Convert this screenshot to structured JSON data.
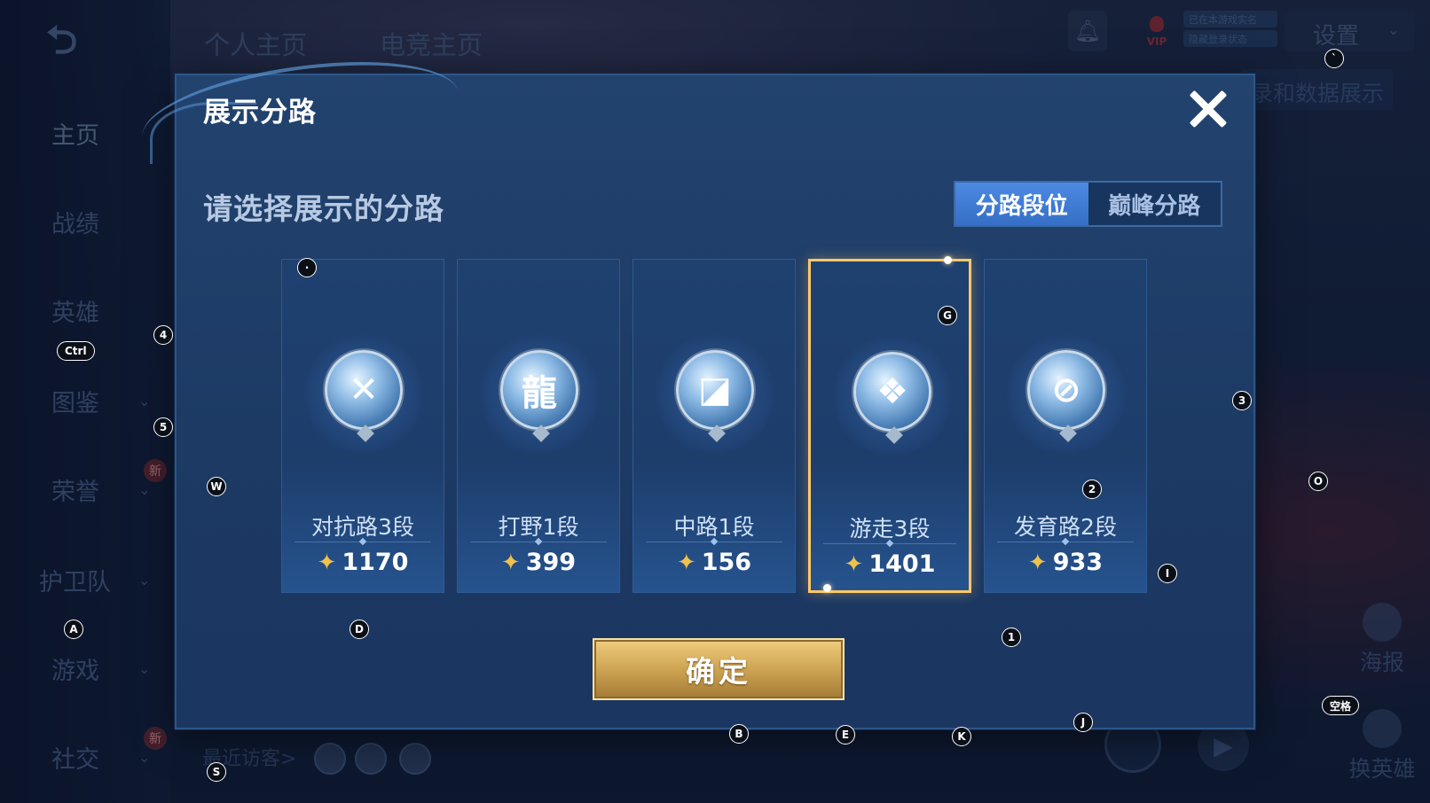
{
  "background": {
    "sidebar": [
      {
        "label": "主页",
        "chevron": false,
        "badge": ""
      },
      {
        "label": "战绩",
        "chevron": false,
        "badge": ""
      },
      {
        "label": "英雄",
        "chevron": false,
        "badge": ""
      },
      {
        "label": "图鉴",
        "chevron": true,
        "badge": ""
      },
      {
        "label": "荣誉",
        "chevron": true,
        "badge": "新"
      },
      {
        "label": "护卫队",
        "chevron": true,
        "badge": ""
      },
      {
        "label": "游戏",
        "chevron": true,
        "badge": ""
      },
      {
        "label": "社交",
        "chevron": true,
        "badge": "新"
      }
    ],
    "top_tabs": [
      "个人主页",
      "电竞主页"
    ],
    "vip_label": "VIP",
    "game_status": [
      "已在本游戏实名",
      "隐藏登录状态"
    ],
    "settings_label": "设置",
    "data_show_label": "录和数据展示",
    "poster_label": "海报",
    "swap_hero_label": "换英雄",
    "recent_visitors_label": "最近访客>"
  },
  "modal": {
    "title": "展示分路",
    "subtitle": "请选择展示的分路",
    "segment_tabs": [
      {
        "label": "分路段位",
        "active": true
      },
      {
        "label": "巅峰分路",
        "active": false
      }
    ],
    "roles": [
      {
        "name": "对抗路3段",
        "score": "1170",
        "icon": "clash-lane-icon",
        "glyph": "✕",
        "selected": false
      },
      {
        "name": "打野1段",
        "score": "399",
        "icon": "jungle-dragon-icon",
        "glyph": "龍",
        "selected": false
      },
      {
        "name": "中路1段",
        "score": "156",
        "icon": "mid-lane-icon",
        "glyph": "◪",
        "selected": false
      },
      {
        "name": "游走3段",
        "score": "1401",
        "icon": "roam-wings-icon",
        "glyph": "❖",
        "selected": true
      },
      {
        "name": "发育路2段",
        "score": "933",
        "icon": "farm-lane-icon",
        "glyph": "⊘",
        "selected": false
      }
    ],
    "score_icon": "flame-icon",
    "confirm_label": "确定",
    "close_icon": "close-icon"
  },
  "key_hints": [
    {
      "key": "`",
      "target": "settings"
    },
    {
      "key": "4",
      "target": "sidebar"
    },
    {
      "key": "Ctrl",
      "target": "sidebar"
    },
    {
      "key": "5",
      "target": "sidebar"
    },
    {
      "key": "W",
      "target": "modal"
    },
    {
      "key": "A",
      "target": "sidebar"
    },
    {
      "key": "S",
      "target": "sidebar"
    },
    {
      "key": "D",
      "target": "modal"
    },
    {
      "key": "·",
      "target": "card-1"
    },
    {
      "key": "G",
      "target": "card-4"
    },
    {
      "key": "3",
      "target": "modal"
    },
    {
      "key": "2",
      "target": "card-5"
    },
    {
      "key": "O",
      "target": "right"
    },
    {
      "key": "I",
      "target": "card-5"
    },
    {
      "key": "1",
      "target": "modal"
    },
    {
      "key": "B",
      "target": "confirm"
    },
    {
      "key": "E",
      "target": "modal"
    },
    {
      "key": "K",
      "target": "modal"
    },
    {
      "key": "J",
      "target": "modal"
    },
    {
      "key": "空格",
      "target": "right"
    }
  ]
}
